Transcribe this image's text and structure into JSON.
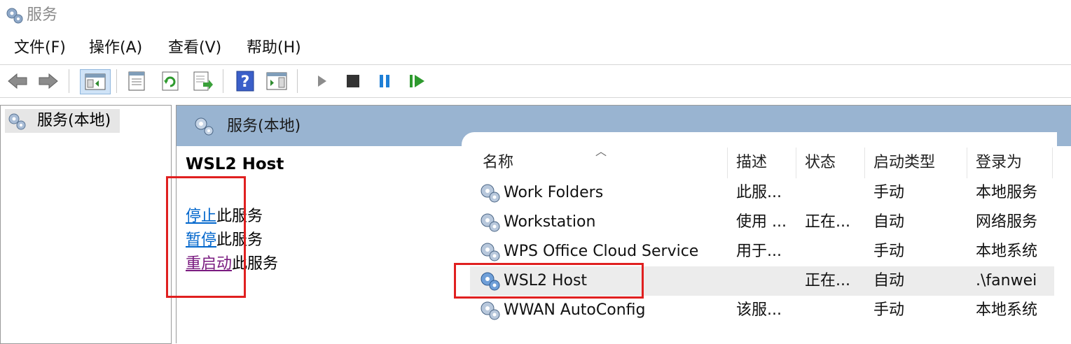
{
  "window": {
    "title": "服务"
  },
  "menu": [
    "文件(F)",
    "操作(A)",
    "查看(V)",
    "帮助(H)"
  ],
  "toolbar": {
    "buttons": [
      "back-icon",
      "forward-icon",
      "show-hide-tree-icon",
      "properties-icon",
      "refresh-icon",
      "export-list-icon",
      "help-icon",
      "show-action-pane-icon",
      "start-service-icon",
      "stop-service-icon",
      "pause-service-icon",
      "resume-service-icon"
    ]
  },
  "tree": {
    "root_label": "服务(本地)"
  },
  "main": {
    "header_title": "服务(本地)",
    "selected_service": "WSL2 Host",
    "actions": [
      {
        "link": "停止",
        "suffix": "此服务"
      },
      {
        "link": "暂停",
        "suffix": "此服务"
      },
      {
        "link": "重启动",
        "suffix": "此服务"
      }
    ]
  },
  "table": {
    "columns": [
      "名称",
      "描述",
      "状态",
      "启动类型",
      "登录为"
    ],
    "rows": [
      {
        "name": "Work Folders",
        "desc": "此服...",
        "status": "",
        "startup": "手动",
        "logon": "本地服务"
      },
      {
        "name": "Workstation",
        "desc": "使用 ...",
        "status": "正在...",
        "startup": "自动",
        "logon": "网络服务"
      },
      {
        "name": "WPS Office Cloud Service",
        "desc": "用于...",
        "status": "",
        "startup": "手动",
        "logon": "本地系统"
      },
      {
        "name": "WSL2 Host",
        "desc": "",
        "status": "正在...",
        "startup": "自动",
        "logon": ".\\fanwei"
      },
      {
        "name": "WWAN AutoConfig",
        "desc": "该服...",
        "status": "",
        "startup": "手动",
        "logon": "本地系统"
      }
    ],
    "selected_index": 3
  },
  "colors": {
    "header_band": "#99b4d1",
    "highlight": "#e02020",
    "link": "#0066cc",
    "visited_link": "#7a1b80"
  }
}
